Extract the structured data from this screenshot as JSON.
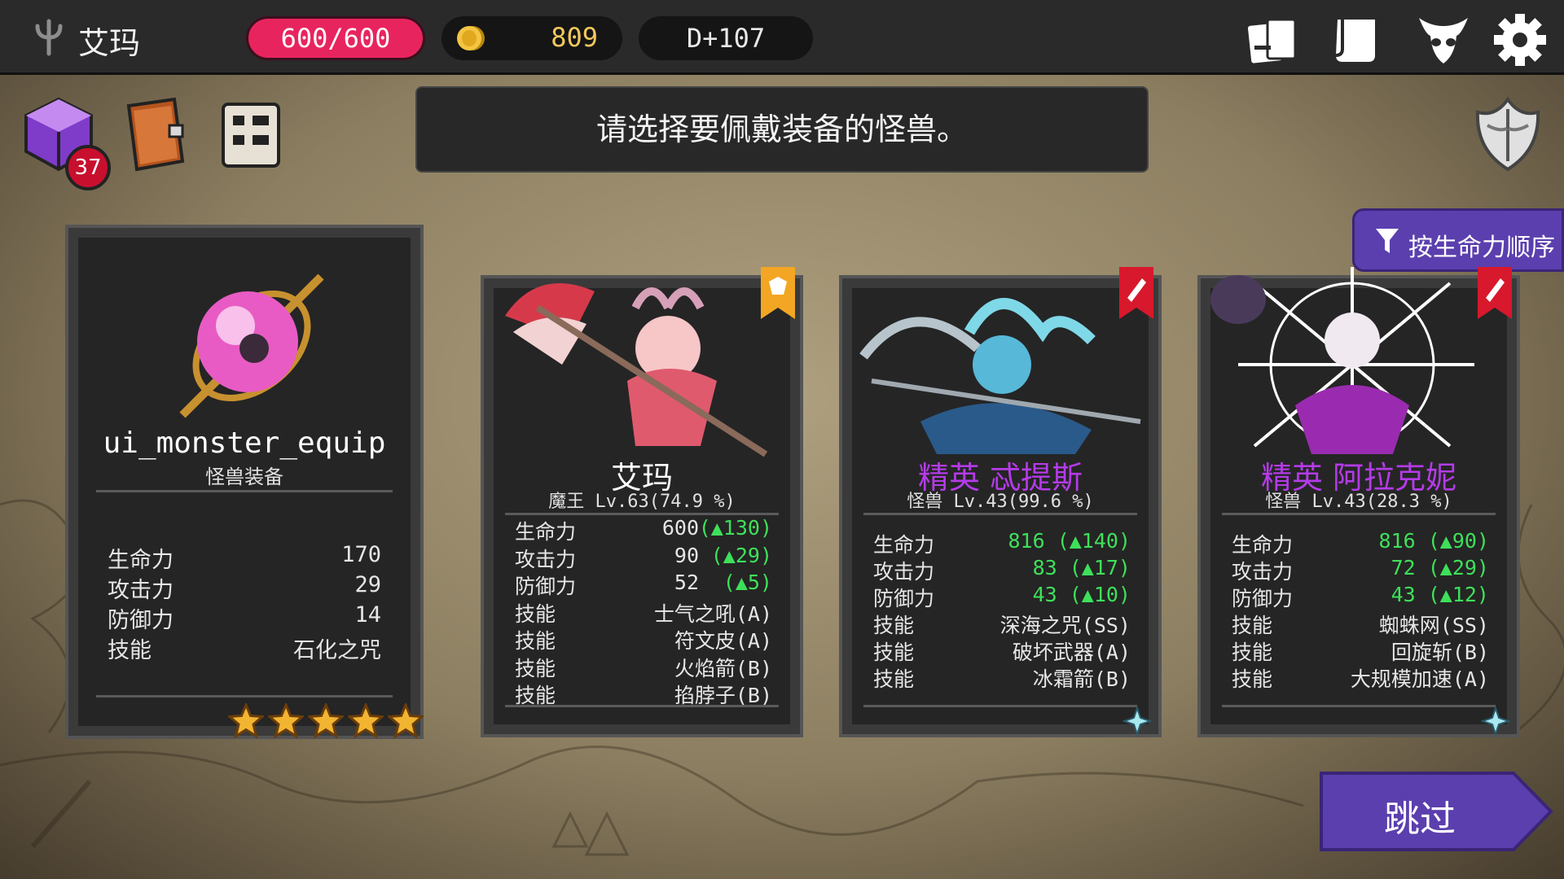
{
  "topbar": {
    "player_name": "艾玛",
    "hp": "600/600",
    "gold": "809",
    "day": "D+107",
    "icons": [
      "card-deck-icon",
      "scroll-map-icon",
      "demon-mask-icon",
      "gear-icon"
    ]
  },
  "quick_icons": {
    "inventory_badge": "37",
    "items": [
      "cube-box-icon",
      "book-icon",
      "quest-scroll-icon"
    ]
  },
  "message": "请选择要佩戴装备的怪兽。",
  "sort_button": "按生命力顺序",
  "skip_button": "跳过",
  "equip_card": {
    "name": "ui_monster_equip",
    "type": "怪兽装备",
    "stats": [
      {
        "label": "生命力",
        "value": "170"
      },
      {
        "label": "攻击力",
        "value": "29"
      },
      {
        "label": "防御力",
        "value": "14"
      },
      {
        "label": "技能",
        "value": "石化之咒"
      }
    ],
    "stars": 5
  },
  "monsters": [
    {
      "name": "艾玛",
      "info": "魔王 Lv.63(74.9 %)",
      "name_color": "#ffffff",
      "stats": [
        {
          "label": "生命力",
          "value": "600",
          "delta": "(▲130)"
        },
        {
          "label": "攻击力",
          "value": "90",
          "delta": "(▲29)"
        },
        {
          "label": "防御力",
          "value": "52",
          "delta": "(▲5)"
        },
        {
          "label": "技能",
          "value": "士气之吼(A)"
        },
        {
          "label": "技能",
          "value": "符文皮(A)"
        },
        {
          "label": "技能",
          "value": "火焰箭(B)"
        },
        {
          "label": "技能",
          "value": "掐脖子(B)"
        }
      ]
    },
    {
      "name": "精英 忒提斯",
      "info": "怪兽 Lv.43(99.6 %)",
      "name_color": "#b43be8",
      "stats": [
        {
          "label": "生命力",
          "value": "816 (▲140)"
        },
        {
          "label": "攻击力",
          "value": "83 (▲17)"
        },
        {
          "label": "防御力",
          "value": "43 (▲10)"
        },
        {
          "label": "技能",
          "value": "深海之咒(SS)"
        },
        {
          "label": "技能",
          "value": "破坏武器(A)"
        },
        {
          "label": "技能",
          "value": "冰霜箭(B)"
        }
      ]
    },
    {
      "name": "精英 阿拉克妮",
      "info": "怪兽 Lv.43(28.3 %)",
      "name_color": "#b43be8",
      "stats": [
        {
          "label": "生命力",
          "value": "816 (▲90)"
        },
        {
          "label": "攻击力",
          "value": "72 (▲29)"
        },
        {
          "label": "防御力",
          "value": "43 (▲12)"
        },
        {
          "label": "技能",
          "value": "蜘蛛网(SS)"
        },
        {
          "label": "技能",
          "value": "回旋斩(B)"
        },
        {
          "label": "技能",
          "value": "大规模加速(A)"
        }
      ]
    }
  ]
}
